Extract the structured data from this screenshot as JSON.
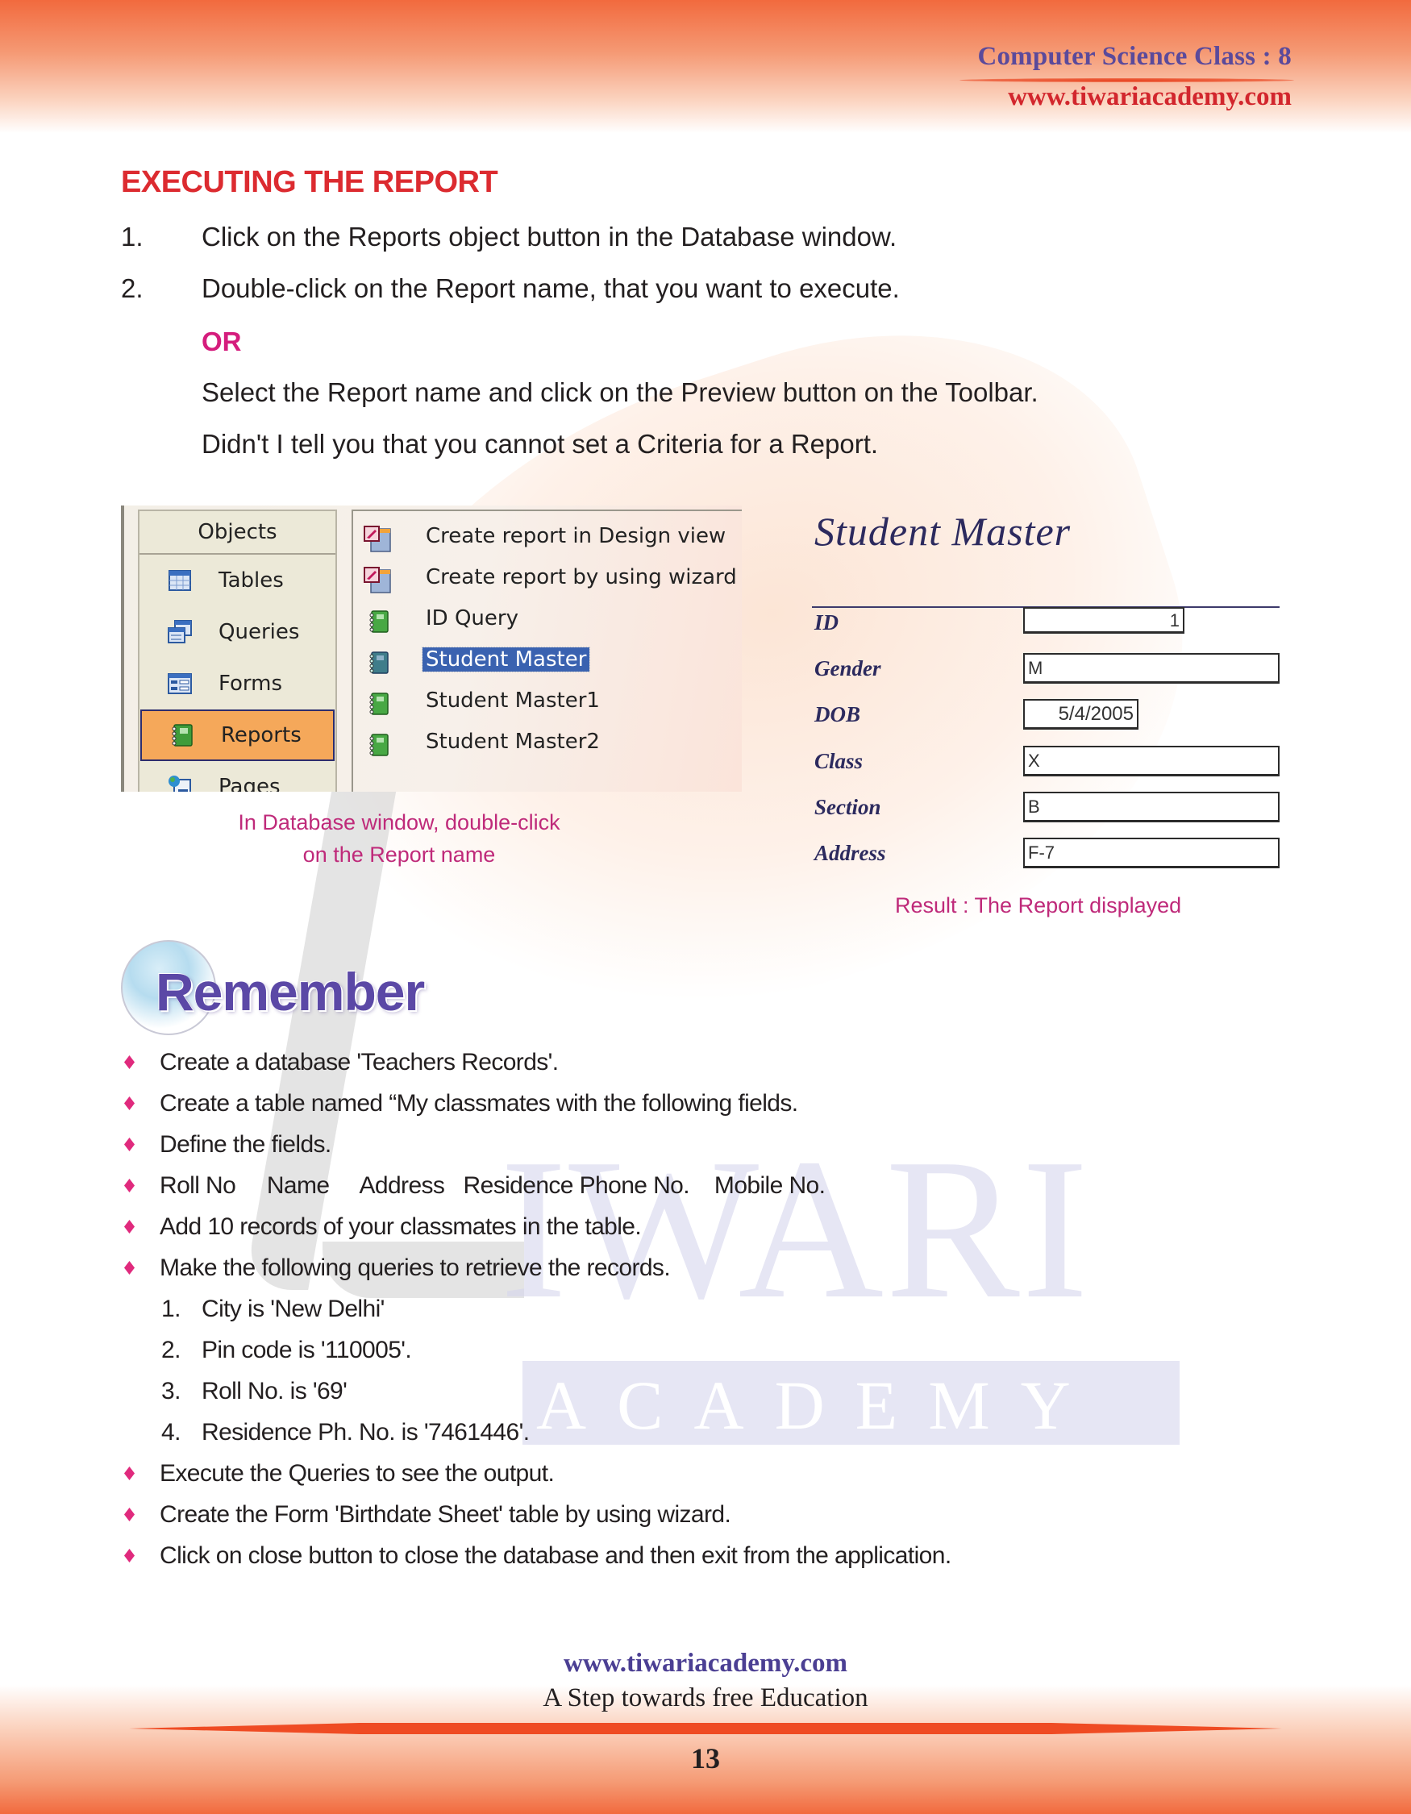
{
  "header": {
    "subject": "Computer Science Class : 8",
    "website": "www.tiwariacademy.com"
  },
  "watermark": {
    "word_main": "IWARI",
    "word_sub": "ACADEMY"
  },
  "section": {
    "heading": "EXECUTING THE REPORT",
    "steps": [
      {
        "num": "1.",
        "text": "Click on the Reports object button in the Database window."
      },
      {
        "num": "2.",
        "text": "Double-click on the Report name, that you want to execute."
      }
    ],
    "or_label": "OR",
    "alt_step": "Select the Report name and click on the Preview button on the Toolbar.",
    "note": "Didn't I tell you that you cannot set a Criteria for a Report."
  },
  "database_window": {
    "objects_header": "Objects",
    "objects": [
      {
        "label": "Tables",
        "icon": "table-icon",
        "selected": false
      },
      {
        "label": "Queries",
        "icon": "query-icon",
        "selected": false
      },
      {
        "label": "Forms",
        "icon": "form-icon",
        "selected": false
      },
      {
        "label": "Reports",
        "icon": "report-icon",
        "selected": true
      },
      {
        "label": "Pages",
        "icon": "page-icon",
        "selected": false
      }
    ],
    "list_items": [
      {
        "label": "Create report in Design view",
        "icon": "design-view-icon",
        "selected": false
      },
      {
        "label": "Create report by using wizard",
        "icon": "wizard-icon",
        "selected": false
      },
      {
        "label": "ID Query",
        "icon": "report-icon",
        "selected": false
      },
      {
        "label": "Student Master",
        "icon": "report-icon",
        "selected": true
      },
      {
        "label": "Student Master1",
        "icon": "report-icon",
        "selected": false
      },
      {
        "label": "Student Master2",
        "icon": "report-icon",
        "selected": false
      }
    ],
    "caption_line1": "In Database window, double-click",
    "caption_line2": "on the Report name"
  },
  "report_preview": {
    "title": "Student Master",
    "fields": [
      {
        "label": "ID",
        "value": "1",
        "align": "right"
      },
      {
        "label": "Gender",
        "value": "M",
        "align": "left"
      },
      {
        "label": "DOB",
        "value": "5/4/2005",
        "align": "right"
      },
      {
        "label": "Class",
        "value": "X",
        "align": "left"
      },
      {
        "label": "Section",
        "value": "B",
        "align": "left"
      },
      {
        "label": "Address",
        "value": "F-7",
        "align": "left"
      }
    ],
    "caption": "Result : The Report displayed"
  },
  "remember": {
    "title": "Remember",
    "bullets": [
      "Create a database 'Teachers Records'.",
      "Create a table named “My classmates with the following fields.",
      "Define the fields.",
      "Roll No     Name     Address   Residence Phone No.    Mobile No.",
      "Add 10 records of your classmates in the table.",
      "Make the following queries to retrieve the records."
    ],
    "queries": [
      {
        "num": "1.",
        "text": "City is 'New Delhi'"
      },
      {
        "num": "2.",
        "text": "Pin code is '110005'."
      },
      {
        "num": "3.",
        "text": "Roll No. is '69'"
      },
      {
        "num": "4.",
        "text": "Residence Ph. No. is '7461446'."
      }
    ],
    "bullets_after": [
      "Execute the Queries to see the output.",
      "Create the Form 'Birthdate Sheet' table by using wizard.",
      "Click on close button to close the database and then exit from the application."
    ]
  },
  "footer": {
    "website": "www.tiwariacademy.com",
    "tagline": "A Step towards free Education",
    "page_number": "13"
  },
  "colors": {
    "brand_orange": "#f26a3e",
    "heading_red": "#dc2b30",
    "accent_magenta": "#d51d7d",
    "brand_purple": "#5b48a6",
    "selection_blue": "#3a62b0",
    "selected_object_orange": "#f5a85a"
  }
}
